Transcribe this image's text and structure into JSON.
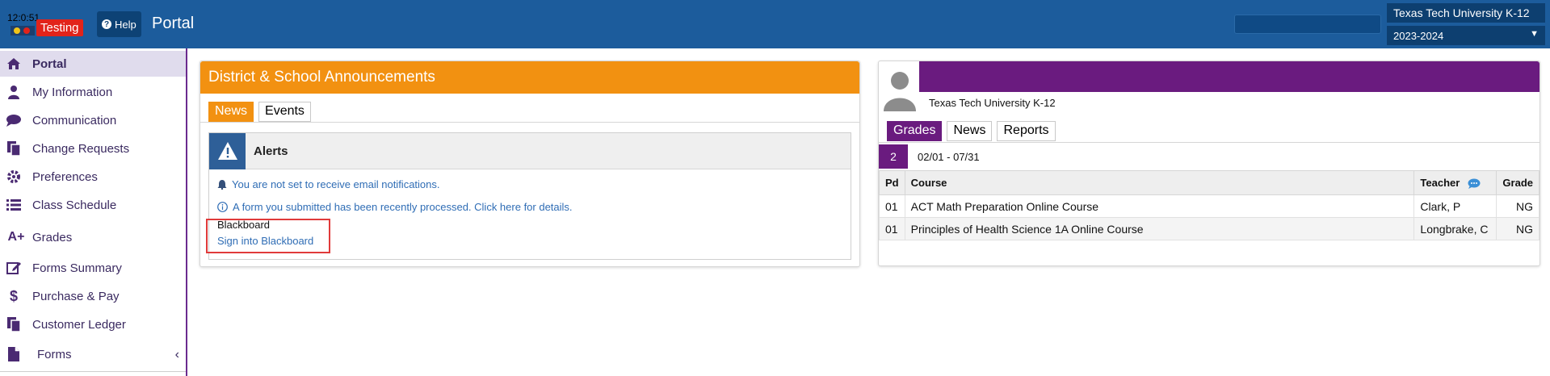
{
  "header": {
    "time": "12:0:51",
    "badge": "Testing",
    "help_label": "Help",
    "app_title": "Portal",
    "school": "Texas Tech University K-12",
    "year": "2023-2024"
  },
  "sidebar": {
    "items": [
      {
        "label": "Portal",
        "icon": "home-icon"
      },
      {
        "label": "My Information",
        "icon": "user-icon"
      },
      {
        "label": "Communication",
        "icon": "chat-icon"
      },
      {
        "label": "Change Requests",
        "icon": "documents-icon"
      },
      {
        "label": "Preferences",
        "icon": "gear-icon"
      },
      {
        "label": "Class Schedule",
        "icon": "list-icon"
      },
      {
        "label": "Grades",
        "icon": "a-plus-icon"
      },
      {
        "label": "Forms Summary",
        "icon": "edit-icon"
      },
      {
        "label": "Purchase & Pay",
        "icon": "dollar-icon"
      },
      {
        "label": "Customer Ledger",
        "icon": "ledger-icon"
      },
      {
        "label": "Forms",
        "icon": "file-icon"
      }
    ]
  },
  "announcements": {
    "title": "District & School Announcements",
    "tabs": [
      "News",
      "Events"
    ],
    "alerts_title": "Alerts",
    "alerts": [
      "You are not set to receive email notifications.",
      "A form you submitted has been recently processed. Click here for details."
    ],
    "blackboard_title": "Blackboard",
    "blackboard_link": "Sign into Blackboard"
  },
  "student": {
    "school": "Texas Tech University K-12",
    "tabs": [
      "Grades",
      "News",
      "Reports"
    ],
    "term_number": "2",
    "term_dates": "02/01 - 07/31",
    "columns": [
      "Pd",
      "Course",
      "Teacher",
      "Grade"
    ],
    "rows": [
      {
        "pd": "01",
        "course": "ACT Math Preparation Online Course",
        "teacher": "Clark, P",
        "grade": "NG"
      },
      {
        "pd": "01",
        "course": "Principles of Health Science 1A Online Course",
        "teacher": "Longbrake, C",
        "grade": "NG"
      }
    ]
  },
  "colors": {
    "header_blue": "#1c5c9c",
    "announce_orange": "#f29111",
    "student_purple": "#6a1b7f",
    "link_blue": "#2f6db5",
    "highlight_red": "#e03a3a"
  }
}
